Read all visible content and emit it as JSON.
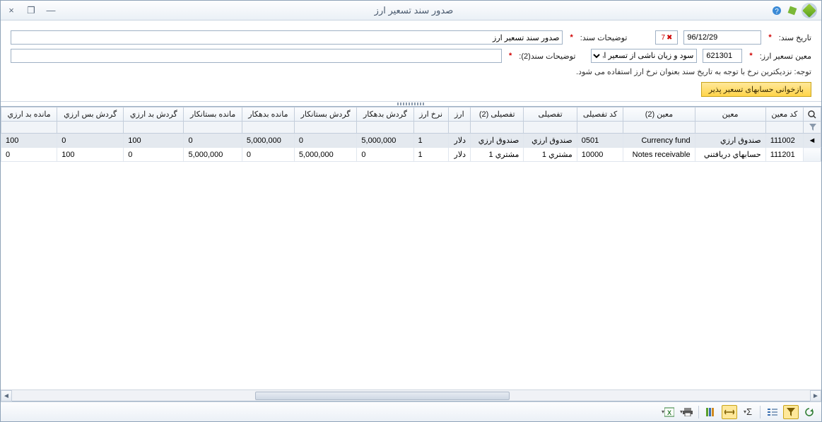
{
  "titlebar": {
    "title": "صدور سند تسعیر ارز",
    "close": "×",
    "max": "❐",
    "min": "—"
  },
  "form": {
    "date_label": "تاریخ سند:",
    "date_value": "96/12/29",
    "desc_label": "توضیحات سند:",
    "desc_value": "صدور سند تسعیر ارز",
    "acc_label": "معین تسعیر ارز:",
    "acc_code": "621301",
    "acc_select": "سود و زیان ناشی از تسعیر ار",
    "desc2_label": "توضیحات سند(2):",
    "desc2_value": "",
    "note": "توجه:  نزدیکترین نرخ با توجه به تاریخ سند بعنوان نرخ ارز استفاده می شود.",
    "reload_btn": "بازخوانی حسابهای تسعیر پذیر"
  },
  "grid": {
    "columns": [
      "کد معین",
      "معین",
      "معین (2)",
      "کد تفصیلی",
      "تفصیلی",
      "تفصیلی (2)",
      "ارز",
      "نرخ ارز",
      "گردش بدهکار",
      "گردش بستانکار",
      "مانده بدهکار",
      "مانده بستانکار",
      "گردش بد ارزي",
      "گردش بس ارزي",
      "مانده بد ارزي"
    ],
    "rows": [
      {
        "code": "111002",
        "moin": "صندوق ارزي",
        "moin2": "Currency fund",
        "tcode": "0501",
        "taf": "صندوق ارزي",
        "taf2": "صندوق ارزي",
        "cur": "دلار",
        "rate": "1",
        "gd": "5,000,000",
        "gb": "0",
        "md": "5,000,000",
        "mb": "0",
        "gda": "100",
        "gba": "0",
        "mda": "100"
      },
      {
        "code": "111201",
        "moin": "حسابهاي دريافتني",
        "moin2": "Notes receivable",
        "tcode": "10000",
        "taf": "مشتري 1",
        "taf2": "مشتري 1",
        "cur": "دلار",
        "rate": "1",
        "gd": "0",
        "gb": "5,000,000",
        "md": "0",
        "mb": "5,000,000",
        "gda": "0",
        "gba": "100",
        "mda": "0"
      }
    ]
  },
  "toolbar": {
    "refresh": "refresh",
    "filter": "filter",
    "group": "group",
    "sigma": "Σ",
    "fit": "fit",
    "cols": "columns",
    "sep": "",
    "print": "print",
    "excel": "excel"
  }
}
